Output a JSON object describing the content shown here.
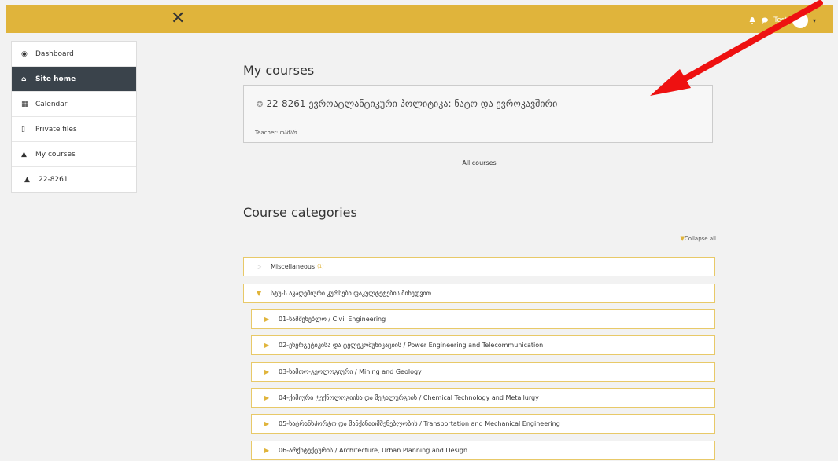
{
  "topbar": {
    "close_icon": "x-close-icon",
    "user_name": "Test",
    "icons": [
      "bell-icon",
      "chat-icon",
      "avatar",
      "caret-down-icon"
    ],
    "accent": "#e0b43b"
  },
  "sidebar": {
    "items": [
      {
        "label": "Dashboard",
        "icon": "dashboard-icon"
      },
      {
        "label": "Site home",
        "icon": "home-icon",
        "active": true
      },
      {
        "label": "Calendar",
        "icon": "calendar-icon"
      },
      {
        "label": "Private files",
        "icon": "file-icon"
      },
      {
        "label": "My courses",
        "icon": "graduation-cap-icon"
      },
      {
        "label": "22-8261",
        "icon": "graduation-cap-icon"
      }
    ],
    "active_color": "#3a434b"
  },
  "main": {
    "my_courses_heading": "My courses",
    "course": {
      "title": "22-8261 ევროატლანტიკური პოლიტიკა: ნატო და ევროკავშირი",
      "teacher": "Teacher: თამარ"
    },
    "all_courses_link": "All courses",
    "categories_heading": "Course categories",
    "collapse_all": "Collapse all",
    "categories": [
      {
        "label": "Miscellaneous",
        "count": "(1)",
        "level": 0,
        "state": "collapsed-muted"
      },
      {
        "label": "სტუ-ს აკადემიური კურსები ფაკულტეტების მიხედვით",
        "level": 0,
        "state": "expanded"
      },
      {
        "label": "01-სამშენებლო / Civil Engineering",
        "level": 1,
        "state": "collapsed"
      },
      {
        "label": "02-ენერგეტიკისა და ტელეკომუნიკაციის / Power Engineering and Telecommunication",
        "level": 1,
        "state": "collapsed"
      },
      {
        "label": "03-სამთო-გეოლოგიური / Mining and Geology",
        "level": 1,
        "state": "collapsed"
      },
      {
        "label": "04-ქიმიური ტექნოლოგიისა და მეტალურგიის / Chemical Technology and Metallurgy",
        "level": 1,
        "state": "collapsed"
      },
      {
        "label": "05-სატრანსპორტო და მანქანათმშენებლობის / Transportation and Mechanical Engineering",
        "level": 1,
        "state": "collapsed"
      },
      {
        "label": "06-არქიტექტურის / Architecture, Urban Planning and Design",
        "level": 1,
        "state": "collapsed"
      }
    ]
  },
  "annotation": {
    "arrow_color": "#ee1111"
  }
}
